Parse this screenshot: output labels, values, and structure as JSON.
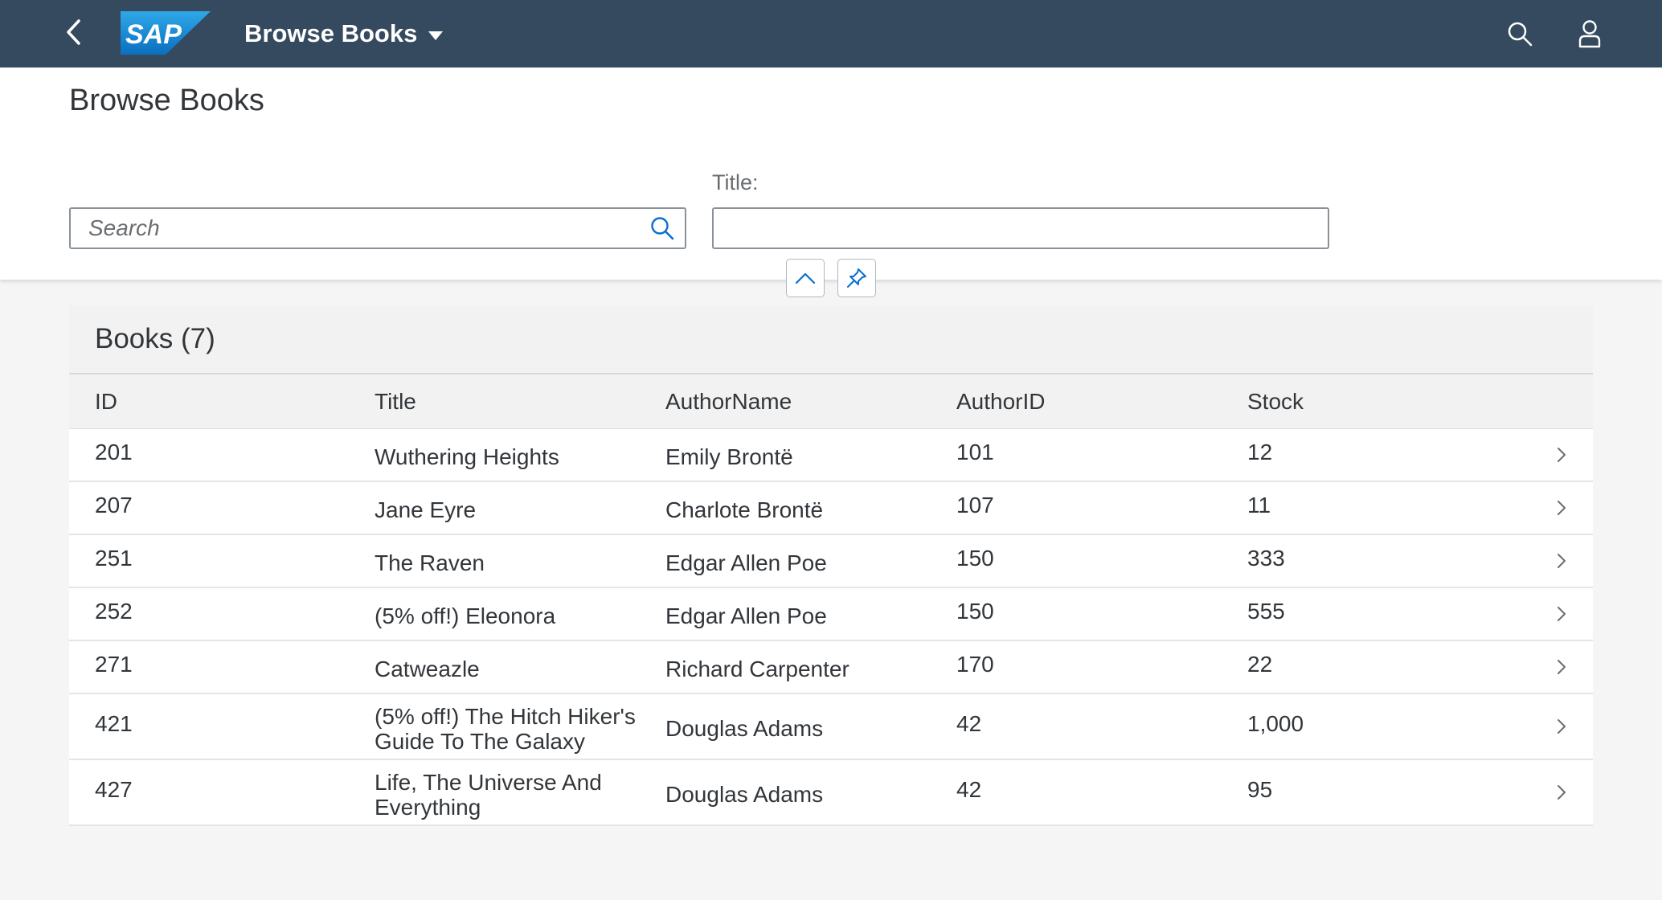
{
  "shell": {
    "logo_text": "SAP",
    "app_title": "Browse Books",
    "colors": {
      "shell_bg": "#354a5f",
      "logo_blue": "#1a8fd8"
    }
  },
  "header": {
    "page_title": "Browse Books",
    "search_placeholder": "Search",
    "title_filter_label": "Title:",
    "title_filter_value": ""
  },
  "table": {
    "title": "Books (7)",
    "columns": [
      "ID",
      "Title",
      "AuthorName",
      "AuthorID",
      "Stock"
    ],
    "rows": [
      {
        "id": "201",
        "title": "Wuthering Heights",
        "author_name": "Emily Brontë",
        "author_id": "101",
        "stock": "12"
      },
      {
        "id": "207",
        "title": "Jane Eyre",
        "author_name": "Charlote Brontë",
        "author_id": "107",
        "stock": "11"
      },
      {
        "id": "251",
        "title": "The Raven",
        "author_name": "Edgar Allen Poe",
        "author_id": "150",
        "stock": "333"
      },
      {
        "id": "252",
        "title": "(5% off!) Eleonora",
        "author_name": "Edgar Allen Poe",
        "author_id": "150",
        "stock": "555"
      },
      {
        "id": "271",
        "title": "Catweazle",
        "author_name": "Richard Carpenter",
        "author_id": "170",
        "stock": "22"
      },
      {
        "id": "421",
        "title": "(5% off!) The Hitch Hiker's Guide To The Galaxy",
        "author_name": "Douglas Adams",
        "author_id": "42",
        "stock": "1,000"
      },
      {
        "id": "427",
        "title": "Life, The Universe And Everything",
        "author_name": "Douglas Adams",
        "author_id": "42",
        "stock": "95"
      }
    ]
  }
}
